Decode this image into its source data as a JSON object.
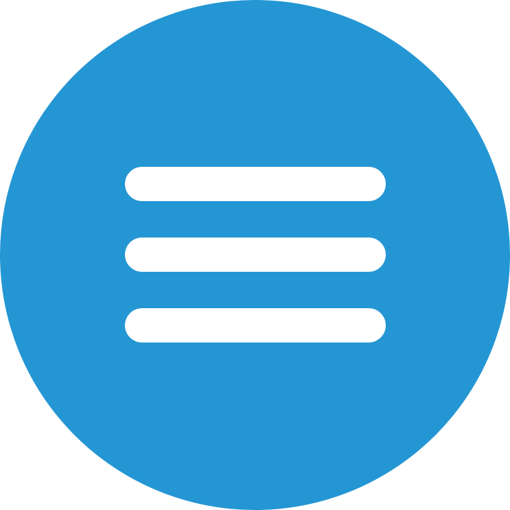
{
  "menu_button": {
    "icon": "hamburger-menu-icon",
    "background_color": "#2496D4",
    "bar_color": "#FFFFFF"
  }
}
